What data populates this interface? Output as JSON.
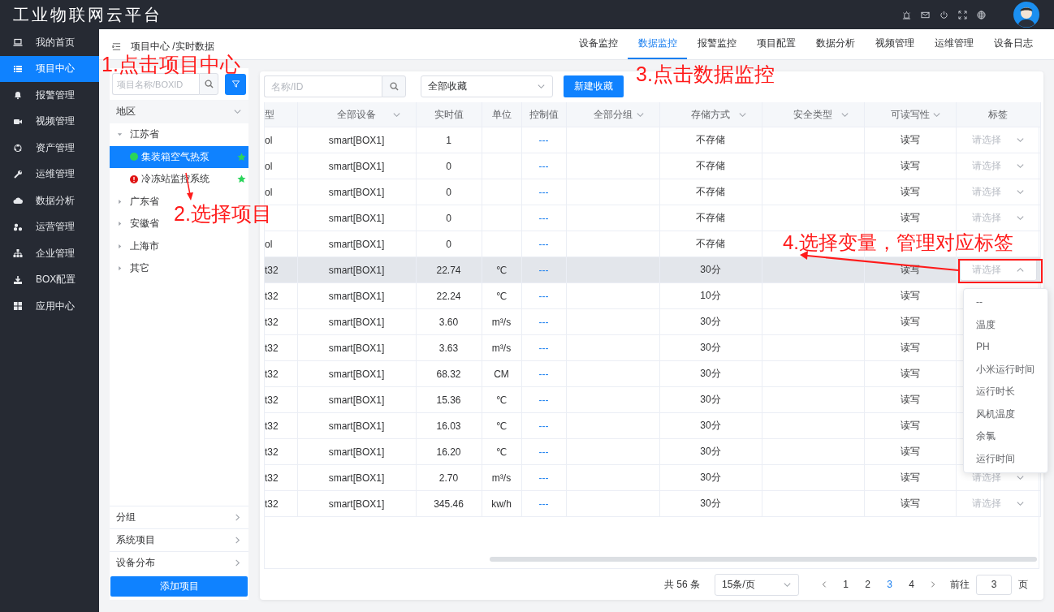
{
  "app_title": "工业物联网云平台",
  "sidebar": {
    "items": [
      {
        "label": "我的首页",
        "selected": false
      },
      {
        "label": "项目中心",
        "selected": true
      },
      {
        "label": "报警管理",
        "selected": false
      },
      {
        "label": "视频管理",
        "selected": false
      },
      {
        "label": "资产管理",
        "selected": false
      },
      {
        "label": "运维管理",
        "selected": false
      },
      {
        "label": "数据分析",
        "selected": false
      },
      {
        "label": "运营管理",
        "selected": false
      },
      {
        "label": "企业管理",
        "selected": false
      },
      {
        "label": "BOX配置",
        "selected": false
      },
      {
        "label": "应用中心",
        "selected": false
      }
    ]
  },
  "breadcrumb": "项目中心 /实时数据",
  "tabs": [
    {
      "label": "设备监控",
      "selected": false
    },
    {
      "label": "数据监控",
      "selected": true
    },
    {
      "label": "报警监控",
      "selected": false
    },
    {
      "label": "项目配置",
      "selected": false
    },
    {
      "label": "数据分析",
      "selected": false
    },
    {
      "label": "视频管理",
      "selected": false
    },
    {
      "label": "运维管理",
      "selected": false
    },
    {
      "label": "设备日志",
      "selected": false
    }
  ],
  "project_panel": {
    "search": {
      "placeholder": "项目名称/BOXID"
    },
    "region_header": "地区",
    "tree": [
      {
        "label": "江苏省",
        "expanded": true,
        "children": [
          {
            "label": "集装箱空气热泵",
            "kind": "online",
            "starred": true,
            "selected": true
          },
          {
            "label": "冷冻站监控系统",
            "kind": "alarm",
            "starred": true,
            "selected": false
          }
        ]
      },
      {
        "label": "广东省",
        "expanded": false
      },
      {
        "label": "安徽省",
        "expanded": false
      },
      {
        "label": "上海市",
        "expanded": false
      },
      {
        "label": "其它",
        "expanded": false
      }
    ],
    "sections": [
      "分组",
      "系统项目",
      "设备分布"
    ],
    "add_button": "添加项目"
  },
  "toolbar": {
    "search": {
      "placeholder": "名称/ID"
    },
    "favorites": "全部收藏",
    "new_button": "新建收藏"
  },
  "table": {
    "columns": [
      {
        "label": "型",
        "filter": false
      },
      {
        "label": "全部设备",
        "filter": true
      },
      {
        "label": "实时值",
        "filter": false
      },
      {
        "label": "单位",
        "filter": false
      },
      {
        "label": "控制值",
        "filter": false
      },
      {
        "label": "全部分组",
        "filter": true
      },
      {
        "label": "存储方式",
        "filter": true
      },
      {
        "label": "安全类型",
        "filter": true
      },
      {
        "label": "可读写性",
        "filter": true
      },
      {
        "label": "标签",
        "filter": false
      }
    ],
    "rows": [
      {
        "type": "ol",
        "device": "smart[BOX1]",
        "value": "1",
        "control": "---",
        "storage": "不存储",
        "access": "读写",
        "tag": "请选择",
        "hovered": false,
        "open": false
      },
      {
        "type": "ol",
        "device": "smart[BOX1]",
        "value": "0",
        "control": "---",
        "storage": "不存储",
        "access": "读写",
        "tag": "请选择",
        "hovered": false,
        "open": false
      },
      {
        "type": "ol",
        "device": "smart[BOX1]",
        "value": "0",
        "control": "---",
        "storage": "不存储",
        "access": "读写",
        "tag": "请选择",
        "hovered": false,
        "open": false
      },
      {
        "device": "smart[BOX1]",
        "value": "0",
        "control": "---",
        "storage": "不存储",
        "access": "读写",
        "tag": "请选择",
        "hovered": false,
        "open": false
      },
      {
        "type": "ol",
        "device": "smart[BOX1]",
        "value": "0",
        "control": "---",
        "storage": "不存储",
        "hovered": false
      },
      {
        "type": "t32",
        "device": "smart[BOX1]",
        "value": "22.74",
        "unit": "℃",
        "control": "---",
        "storage": "30分",
        "access": "读写",
        "tag": "请选择",
        "hovered": true,
        "open": true
      },
      {
        "type": "t32",
        "device": "smart[BOX1]",
        "value": "22.24",
        "unit": "℃",
        "control": "---",
        "storage": "10分",
        "access": "读写",
        "hovered": false
      },
      {
        "type": "t32",
        "device": "smart[BOX1]",
        "value": "3.60",
        "unit": "m³/s",
        "control": "---",
        "storage": "30分",
        "access": "读写",
        "hovered": false
      },
      {
        "type": "t32",
        "device": "smart[BOX1]",
        "value": "3.63",
        "unit": "m³/s",
        "control": "---",
        "storage": "30分",
        "access": "读写",
        "hovered": false
      },
      {
        "type": "t32",
        "device": "smart[BOX1]",
        "value": "68.32",
        "unit": "CM",
        "control": "---",
        "storage": "30分",
        "access": "读写",
        "hovered": false
      },
      {
        "type": "t32",
        "device": "smart[BOX1]",
        "value": "15.36",
        "unit": "℃",
        "control": "---",
        "storage": "30分",
        "access": "读写",
        "hovered": false
      },
      {
        "type": "t32",
        "device": "smart[BOX1]",
        "value": "16.03",
        "unit": "℃",
        "control": "---",
        "storage": "30分",
        "access": "读写",
        "hovered": false
      },
      {
        "type": "t32",
        "device": "smart[BOX1]",
        "value": "16.20",
        "unit": "℃",
        "control": "---",
        "storage": "30分",
        "access": "读写",
        "hovered": false
      },
      {
        "type": "t32",
        "device": "smart[BOX1]",
        "value": "2.70",
        "unit": "m³/s",
        "control": "---",
        "storage": "30分",
        "access": "读写",
        "tag": "请选择",
        "hovered": false,
        "open": false
      },
      {
        "type": "t32",
        "device": "smart[BOX1]",
        "value": "345.46",
        "unit": "kw/h",
        "control": "---",
        "storage": "30分",
        "access": "读写",
        "tag": "请选择",
        "hovered": false,
        "open": false
      }
    ]
  },
  "tag_dropdown": [
    "--",
    "温度",
    "PH",
    "小米运行时间",
    "运行时长",
    "风机温度",
    "余氯",
    "运行时间"
  ],
  "pagination": {
    "total": "共 56 条",
    "page_size": "15条/页",
    "pages": [
      {
        "label": "1",
        "selected": false
      },
      {
        "label": "2",
        "selected": false
      },
      {
        "label": "3",
        "selected": true
      },
      {
        "label": "4",
        "selected": false
      }
    ],
    "goto_label": "前往",
    "goto_value": "3",
    "goto_suffix": "页"
  },
  "annotations": [
    "1.点击项目中心",
    "2.选择项目",
    "3.点击数据监控",
    "4.选择变量，管理对应标签"
  ]
}
